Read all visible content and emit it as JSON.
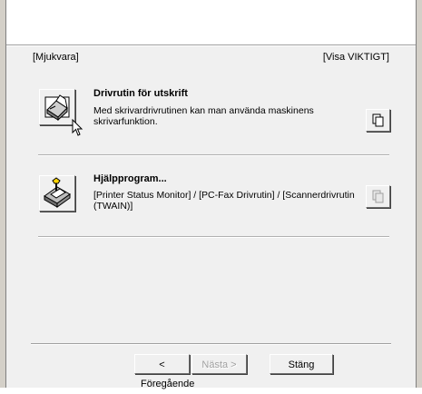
{
  "header": {
    "left_label": "[Mjukvara]",
    "right_label": "[Visa VIKTIGT]"
  },
  "options": [
    {
      "title": "Drivrutin för utskrift",
      "description": "Med skrivardrivrutinen kan man använda maskinens skrivarfunktion.",
      "icon": "printer-icon",
      "doc_button_enabled": true
    },
    {
      "title": "Hjälpprogram...",
      "description": "[Printer Status Monitor] / [PC-Fax Drivrutin] / [Scannerdrivrutin (TWAIN)]",
      "icon": "utility-tools-icon",
      "doc_button_enabled": false
    }
  ],
  "footer": {
    "back_label": "< Föregående",
    "next_label": "Nästa >",
    "close_label": "Stäng"
  }
}
